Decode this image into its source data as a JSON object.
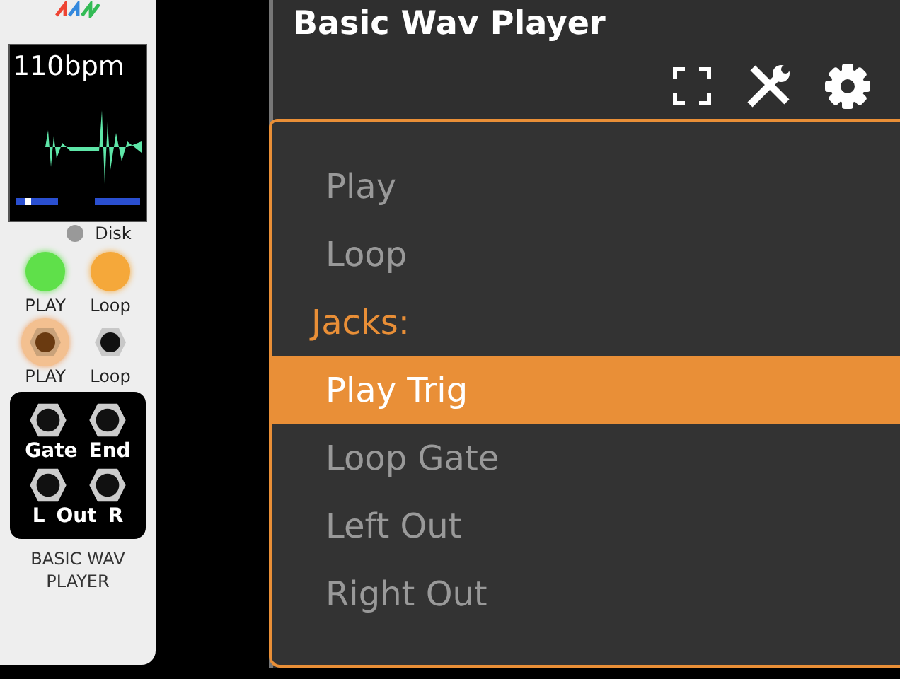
{
  "module": {
    "display": {
      "tempo": "110bpm"
    },
    "disk": {
      "label": "Disk",
      "on": false
    },
    "buttons": [
      {
        "label": "PLAY",
        "color": "#5fe04a"
      },
      {
        "label": "Loop",
        "color": "#f5a83a"
      }
    ],
    "jacks": [
      {
        "label": "PLAY",
        "highlighted": true
      },
      {
        "label": "Loop",
        "highlighted": false
      }
    ],
    "jack_box": {
      "row_1": [
        "Gate",
        "End"
      ],
      "row_2": [
        "L",
        "Out",
        "R"
      ]
    },
    "name": [
      "BASIC WAV",
      "PLAYER"
    ]
  },
  "panel": {
    "title": "Basic Wav Player"
  },
  "menu": [
    {
      "kind": "item",
      "label": "Play",
      "selected": false
    },
    {
      "kind": "item",
      "label": "Loop",
      "selected": false
    },
    {
      "kind": "heading",
      "label": "Jacks:"
    },
    {
      "kind": "item",
      "label": "Play Trig",
      "selected": true
    },
    {
      "kind": "item",
      "label": "Loop Gate",
      "selected": false
    },
    {
      "kind": "item",
      "label": "Left Out",
      "selected": false
    },
    {
      "kind": "item",
      "label": "Right Out",
      "selected": false
    }
  ]
}
